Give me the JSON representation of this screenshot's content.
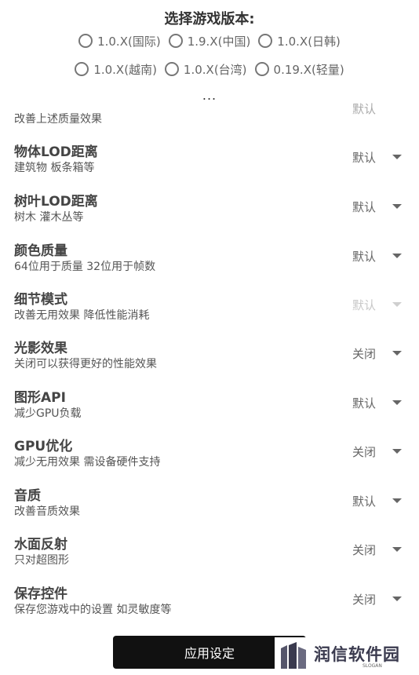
{
  "header": {
    "title": "选择游戏版本:",
    "versions_row1": [
      "1.0.X(国际)",
      "1.9.X(中国)",
      "1.0.X(日韩)"
    ],
    "versions_row2": [
      "1.0.X(越南)",
      "1.0.X(台湾)",
      "0.19.X(轻量)"
    ],
    "more": "..."
  },
  "partial_item": {
    "desc": "改善上述质量效果",
    "value": "默认"
  },
  "settings": [
    {
      "name": "物体LOD距离",
      "desc": "建筑物 板条箱等",
      "value": "默认",
      "enabled": true
    },
    {
      "name": "树叶LOD距离",
      "desc": "树木 灌木丛等",
      "value": "默认",
      "enabled": true
    },
    {
      "name": "颜色质量",
      "desc": "64位用于质量 32位用于帧数",
      "value": "默认",
      "enabled": true
    },
    {
      "name": "细节模式",
      "desc": "改善无用效果 降低性能消耗",
      "value": "默认",
      "enabled": false
    },
    {
      "name": "光影效果",
      "desc": "关闭可以获得更好的性能效果",
      "value": "关闭",
      "enabled": true
    },
    {
      "name": "图形API",
      "desc": "减少GPU负载",
      "value": "默认",
      "enabled": true
    },
    {
      "name": "GPU优化",
      "desc": "减少无用效果 需设备硬件支持",
      "value": "关闭",
      "enabled": true
    },
    {
      "name": "音质",
      "desc": "改善音质效果",
      "value": "默认",
      "enabled": true
    },
    {
      "name": "水面反射",
      "desc": "只对超图形",
      "value": "关闭",
      "enabled": true
    },
    {
      "name": "保存控件",
      "desc": "保存您游戏中的设置 如灵敏度等",
      "value": "关闭",
      "enabled": true
    }
  ],
  "apply_button": "应用设定",
  "watermark": {
    "text": "润信软件园",
    "slogan": "SLOGAN"
  }
}
